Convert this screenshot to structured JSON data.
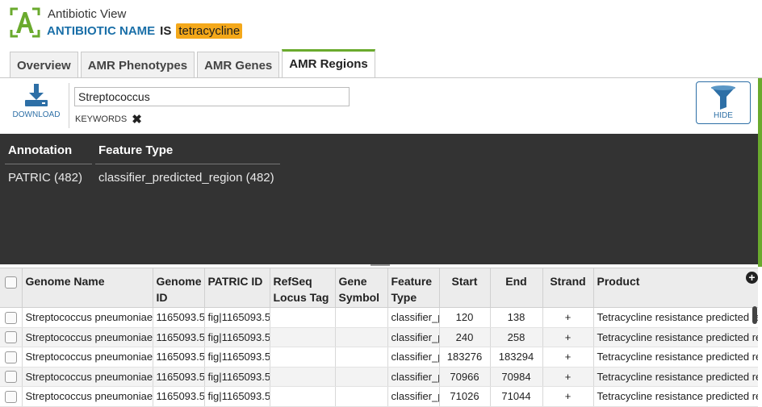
{
  "header": {
    "app_name": "Antibiotic View",
    "query_key": "ANTIBIOTIC NAME",
    "query_op": "IS",
    "query_value": "tetracycline"
  },
  "tabs": [
    {
      "label": "Overview",
      "active": false
    },
    {
      "label": "AMR Phenotypes",
      "active": false
    },
    {
      "label": "AMR Genes",
      "active": false
    },
    {
      "label": "AMR Regions",
      "active": true
    }
  ],
  "toolbar": {
    "download_label": "DOWNLOAD",
    "search_value": "Streptococcus",
    "keywords_label": "KEYWORDS",
    "hide_label": "HIDE"
  },
  "facets": {
    "annotation": {
      "header": "Annotation",
      "item": "PATRIC (482)"
    },
    "feature_type": {
      "header": "Feature Type",
      "item": "classifier_predicted_region (482)"
    }
  },
  "table": {
    "columns": [
      "Genome Name",
      "Genome ID",
      "PATRIC ID",
      "RefSeq Locus Tag",
      "Gene Symbol",
      "Feature Type",
      "Start",
      "End",
      "Strand",
      "Product"
    ],
    "rows": [
      {
        "genome_name": "Streptococcus pneumoniae C",
        "genome_id": "1165093.5",
        "patric_id": "fig|1165093.5.",
        "refseq": "",
        "gene": "",
        "feature_type": "classifier_p",
        "start": "120",
        "end": "138",
        "strand": "+",
        "product": "Tetracycline resistance predicted re"
      },
      {
        "genome_name": "Streptococcus pneumoniae C",
        "genome_id": "1165093.5",
        "patric_id": "fig|1165093.5.",
        "refseq": "",
        "gene": "",
        "feature_type": "classifier_p",
        "start": "240",
        "end": "258",
        "strand": "+",
        "product": "Tetracycline resistance predicted re"
      },
      {
        "genome_name": "Streptococcus pneumoniae C",
        "genome_id": "1165093.5",
        "patric_id": "fig|1165093.5.",
        "refseq": "",
        "gene": "",
        "feature_type": "classifier_p",
        "start": "183276",
        "end": "183294",
        "strand": "+",
        "product": "Tetracycline resistance predicted re"
      },
      {
        "genome_name": "Streptococcus pneumoniae C",
        "genome_id": "1165093.5",
        "patric_id": "fig|1165093.5.",
        "refseq": "",
        "gene": "",
        "feature_type": "classifier_p",
        "start": "70966",
        "end": "70984",
        "strand": "+",
        "product": "Tetracycline resistance predicted re"
      },
      {
        "genome_name": "Streptococcus pneumoniae C",
        "genome_id": "1165093.5",
        "patric_id": "fig|1165093.5.",
        "refseq": "",
        "gene": "",
        "feature_type": "classifier_p",
        "start": "71026",
        "end": "71044",
        "strand": "+",
        "product": "Tetracycline resistance predicted re"
      }
    ]
  },
  "colors": {
    "accent_green": "#6aaa2d",
    "brand_blue": "#1a6fa8",
    "highlight_orange": "#f4a81a",
    "panel_dark": "#333333"
  },
  "icons": [
    "logo-a-icon",
    "download-icon",
    "close-icon",
    "filter-funnel-icon",
    "plus-circle-icon"
  ]
}
